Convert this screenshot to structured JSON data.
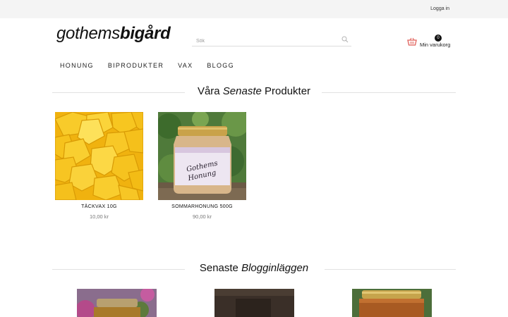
{
  "header": {
    "login": "Logga in",
    "logo_light": "gothems",
    "logo_bold": "bigård",
    "search_placeholder": "Sök",
    "cart_count": "0",
    "cart_label": "Min varukorg"
  },
  "nav": [
    "HONUNG",
    "BIPRODUKTER",
    "VAX",
    "BLOGG"
  ],
  "products_section": {
    "title_pre": "Våra ",
    "title_italic": "Senaste",
    "title_post": " Produkter"
  },
  "products": [
    {
      "name": "TÄCKVAX 10G",
      "price": "10,00 kr",
      "image": "beeswax-cubes"
    },
    {
      "name": "SOMMARHONUNG 500G",
      "price": "90,00 kr",
      "image": "honey-jar"
    }
  ],
  "blog_section": {
    "title_pre": "Senaste ",
    "title_italic": "Blogginläggen"
  },
  "colors": {
    "topbar_bg": "#f4f4f4",
    "cart_icon": "#e0605a",
    "price": "#777777",
    "wax": "#f6c21c",
    "divider": "#e2e2e2"
  }
}
